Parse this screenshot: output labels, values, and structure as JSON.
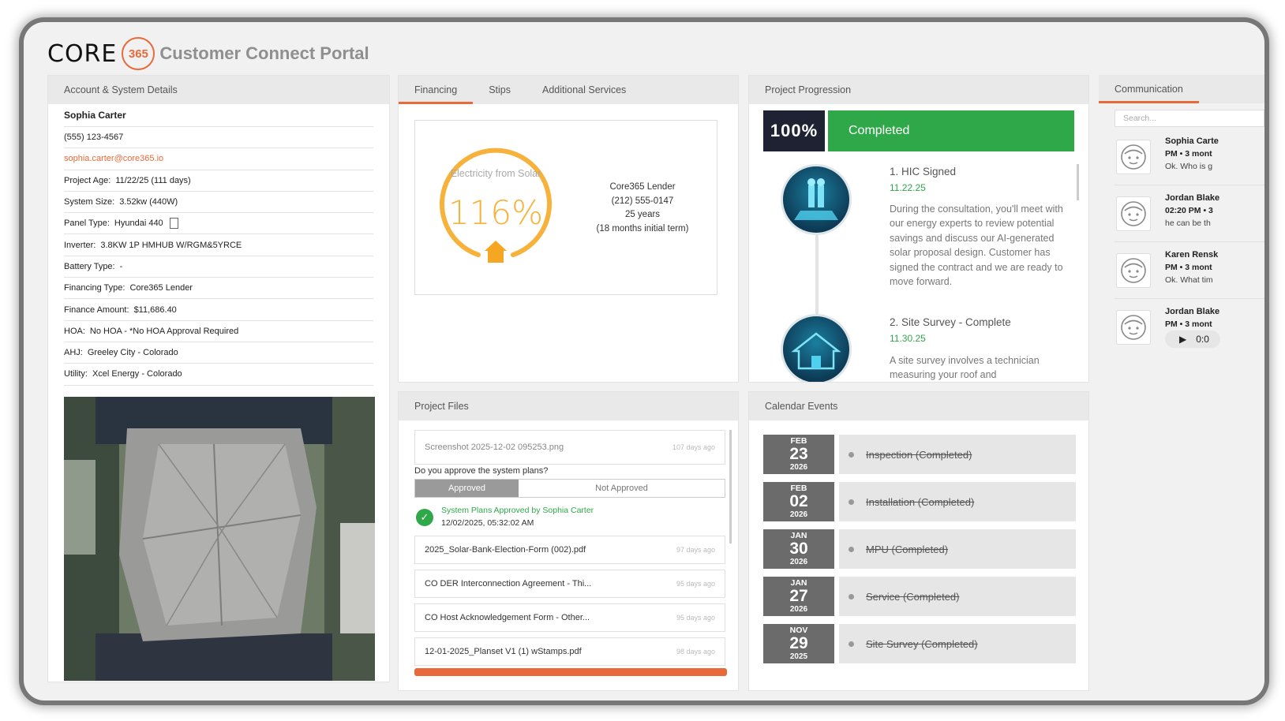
{
  "header": {
    "logo_text": "CORE",
    "logo_badge": "365",
    "title": "Customer Connect Portal"
  },
  "account": {
    "panel_title": "Account & System Details",
    "name": "Sophia Carter",
    "phone": "(555) 123-4567",
    "email": "sophia.carter@core365.io",
    "fields": [
      {
        "k": "Project Age:",
        "v": "11/22/25 (111 days)"
      },
      {
        "k": "System Size:",
        "v": "3.52kw (440W)"
      },
      {
        "k": "Panel Type:",
        "v": "Hyundai 440"
      },
      {
        "k": "Inverter:",
        "v": "3.8KW 1P HMHUB W/RGM&5YRCE"
      },
      {
        "k": "Battery Type:",
        "v": "-"
      },
      {
        "k": "Financing Type:",
        "v": "Core365 Lender"
      },
      {
        "k": "Finance Amount:",
        "v": "$11,686.40"
      },
      {
        "k": "HOA:",
        "v": "No HOA - *No HOA Approval Required"
      },
      {
        "k": "AHJ:",
        "v": "Greeley City - Colorado"
      },
      {
        "k": "Utility:",
        "v": "Xcel Energy - Colorado"
      }
    ]
  },
  "financing": {
    "tabs": [
      "Financing",
      "Stips",
      "Additional Services"
    ],
    "gauge_label": "Electricity from Solar",
    "gauge_value": "116%",
    "gauge_fraction": 1.0,
    "lender_name": "Core365 Lender",
    "lender_phone": "(212) 555-0147",
    "term": "25 years",
    "initial_term": "(18 months initial term)"
  },
  "progression": {
    "panel_title": "Project Progression",
    "percent": "100%",
    "status": "Completed",
    "steps": [
      {
        "title": "1. HIC Signed",
        "date": "11.22.25",
        "desc": "During the consultation, you'll meet with our energy experts to review potential savings and discuss our AI-generated solar proposal design. Customer has signed the contract and we are ready to move forward."
      },
      {
        "title": "2. Site Survey - Complete",
        "date": "11.30.25",
        "desc": "A site survey involves a technician measuring your roof and"
      }
    ]
  },
  "communication": {
    "tab": "Communication",
    "search_placeholder": "Search...",
    "messages": [
      {
        "name": "Sophia Carte",
        "time": "PM • 3 mont",
        "text": "Ok. Who is g"
      },
      {
        "name": "Jordan Blake",
        "time": "02:20 PM • 3",
        "text": "he can be th"
      },
      {
        "name": "Karen Rensk",
        "time": "PM • 3 mont",
        "text": "Ok. What tim"
      },
      {
        "name": "Jordan Blake",
        "time": "PM • 3 mont",
        "text": "0:0"
      }
    ]
  },
  "files": {
    "panel_title": "Project Files",
    "first_file": {
      "name": "Screenshot 2025-12-02 095253.png",
      "ago": "107 days ago"
    },
    "approval_question": "Do you approve the system plans?",
    "approved_label": "Approved",
    "not_approved_label": "Not Approved",
    "approved_note": "System Plans Approved by Sophia Carter",
    "approved_date": "12/02/2025, 05:32:02 AM",
    "list": [
      {
        "name": "2025_Solar-Bank-Election-Form (002).pdf",
        "ago": "97 days ago"
      },
      {
        "name": "CO DER Interconnection Agreement - Thi...",
        "ago": "95 days ago"
      },
      {
        "name": "CO Host Acknowledgement Form - Other...",
        "ago": "95 days ago"
      },
      {
        "name": "12-01-2025_Planset V1 (1) wStamps.pdf",
        "ago": "98 days ago"
      }
    ]
  },
  "calendar": {
    "panel_title": "Calendar Events",
    "events": [
      {
        "mon": "FEB",
        "day": "23",
        "yr": "2026",
        "label": "Inspection (Completed)"
      },
      {
        "mon": "FEB",
        "day": "02",
        "yr": "2026",
        "label": "Installation (Completed)"
      },
      {
        "mon": "JAN",
        "day": "30",
        "yr": "2026",
        "label": "MPU (Completed)"
      },
      {
        "mon": "JAN",
        "day": "27",
        "yr": "2026",
        "label": "Service (Completed)"
      },
      {
        "mon": "NOV",
        "day": "29",
        "yr": "2025",
        "label": "Site Survey (Completed)"
      }
    ]
  },
  "colors": {
    "accent": "#e86a3a",
    "success": "#2fa84a",
    "gauge": "#f6b23b",
    "dark": "#1e2233"
  }
}
